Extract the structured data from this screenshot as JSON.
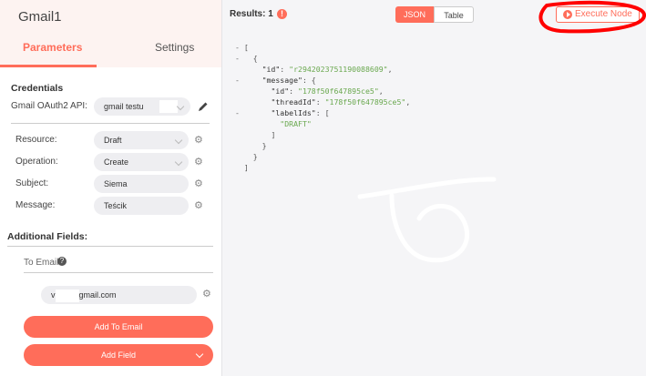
{
  "node": {
    "title": "Gmail1"
  },
  "tabs": [
    {
      "label": "Parameters",
      "active": true
    },
    {
      "label": "Settings",
      "active": false
    }
  ],
  "credentials": {
    "section_title": "Credentials",
    "api_label": "Gmail OAuth2 API:",
    "api_value": "gmail testu"
  },
  "params": [
    {
      "label": "Resource:",
      "value": "Draft",
      "dropdown": true
    },
    {
      "label": "Operation:",
      "value": "Create",
      "dropdown": true
    },
    {
      "label": "Subject:",
      "value": "Siema",
      "dropdown": false
    },
    {
      "label": "Message:",
      "value": "Teścik",
      "dropdown": false
    }
  ],
  "additional": {
    "section_title": "Additional Fields:",
    "to_email_label": "To Email:",
    "email_prefix": "v",
    "email_suffix": "gmail.com",
    "add_to_email_button": "Add To Email",
    "add_field_button": "Add Field"
  },
  "results": {
    "label": "Results: 1",
    "warning_icon": "!",
    "view_json": "JSON",
    "view_table": "Table",
    "execute_button": "Execute Node"
  },
  "json_lines": [
    {
      "toggle": "-",
      "indent": 0,
      "parts": [
        {
          "t": "[",
          "c": "p"
        }
      ]
    },
    {
      "toggle": "-",
      "indent": 1,
      "parts": [
        {
          "t": "{",
          "c": "p"
        }
      ]
    },
    {
      "toggle": "",
      "indent": 2,
      "parts": [
        {
          "t": "\"id\"",
          "c": "k"
        },
        {
          "t": ": ",
          "c": "p"
        },
        {
          "t": "\"r2942023751190088609\"",
          "c": "s"
        },
        {
          "t": ",",
          "c": "p"
        }
      ]
    },
    {
      "toggle": "-",
      "indent": 2,
      "parts": [
        {
          "t": "\"message\"",
          "c": "k"
        },
        {
          "t": ": {",
          "c": "p"
        }
      ]
    },
    {
      "toggle": "",
      "indent": 3,
      "parts": [
        {
          "t": "\"id\"",
          "c": "k"
        },
        {
          "t": ": ",
          "c": "p"
        },
        {
          "t": "\"178f50f647895ce5\"",
          "c": "s"
        },
        {
          "t": ",",
          "c": "p"
        }
      ]
    },
    {
      "toggle": "",
      "indent": 3,
      "parts": [
        {
          "t": "\"threadId\"",
          "c": "k"
        },
        {
          "t": ": ",
          "c": "p"
        },
        {
          "t": "\"178f50f647895ce5\"",
          "c": "s"
        },
        {
          "t": ",",
          "c": "p"
        }
      ]
    },
    {
      "toggle": "-",
      "indent": 3,
      "parts": [
        {
          "t": "\"labelIds\"",
          "c": "k"
        },
        {
          "t": ": [",
          "c": "p"
        }
      ]
    },
    {
      "toggle": "",
      "indent": 4,
      "parts": [
        {
          "t": "\"DRAFT\"",
          "c": "s"
        }
      ]
    },
    {
      "toggle": "",
      "indent": 3,
      "parts": [
        {
          "t": "]",
          "c": "p"
        }
      ]
    },
    {
      "toggle": "",
      "indent": 2,
      "parts": [
        {
          "t": "}",
          "c": "p"
        }
      ]
    },
    {
      "toggle": "",
      "indent": 1,
      "parts": [
        {
          "t": "}",
          "c": "p"
        }
      ]
    },
    {
      "toggle": "",
      "indent": 0,
      "parts": [
        {
          "t": "]",
          "c": "p"
        }
      ]
    }
  ],
  "colors": {
    "accent": "#ff6d5a",
    "annotation": "#ff0000",
    "scribble": "#ffffff"
  }
}
